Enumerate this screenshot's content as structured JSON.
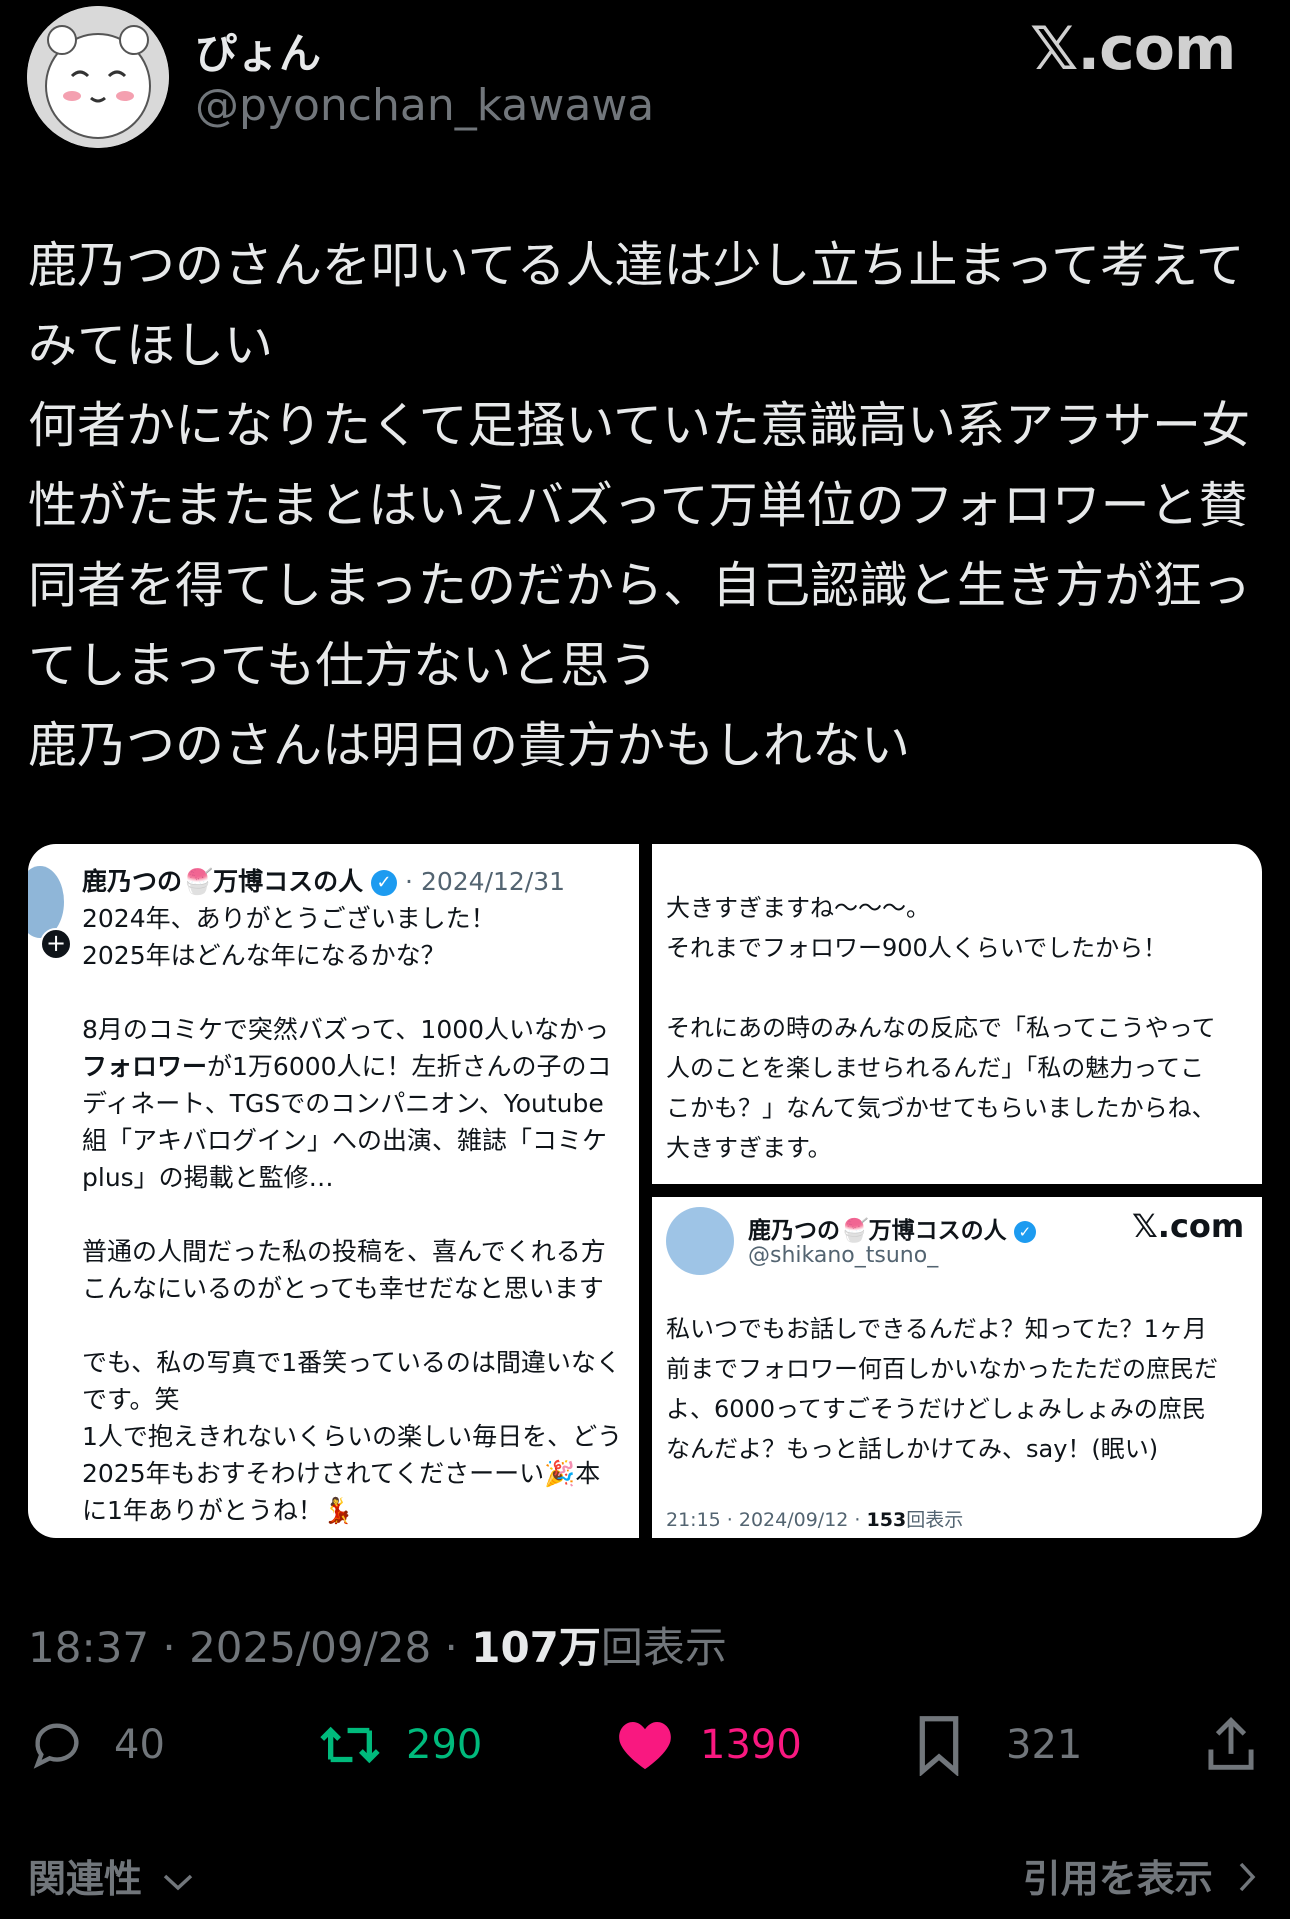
{
  "header": {
    "display_name": "ぴょん",
    "handle": "@pyonchan_kawawa",
    "watermark": "𝕏.com"
  },
  "tweet": {
    "text": "鹿乃つのさんを叩いてる人達は少し立ち止まって考えてみてほしい\n何者かになりたくて足掻いていた意識高い系アラサー女性がたまたまとはいえバズって万単位のフォロワーと賛同者を得てしまったのだから、自己認識と生き方が狂ってしまっても仕方ないと思う\n鹿乃つのさんは明日の貴方かもしれない"
  },
  "media": {
    "card1": {
      "name": "鹿乃つの🍧万博コスの人",
      "date": "· 2024/12/31",
      "lines": [
        "2024年、ありがとうございました！",
        "2025年はどんな年になるかな？",
        "",
        "8月のコミケで突然バズって、1000人いなかっ",
        "フォロワーが1万6000人に！左折さんの子のコ",
        "ディネート、TGSでのコンパニオン、Youtube",
        "組「アキバログイン」への出演、雑誌「コミケ",
        "plus」の掲載と監修…",
        "",
        "普通の人間だった私の投稿を、喜んでくれる方",
        "こんなにいるのがとっても幸せだなと思います",
        "",
        "でも、私の写真で1番笑っているのは間違いなく",
        "です。笑",
        "1人で抱えきれないくらいの楽しい毎日を、どう",
        "2025年もおすそわけされてくださーーい🎉本",
        "に1年ありがとうね！💃"
      ]
    },
    "card2": {
      "lines": [
        "大きすぎますね〜〜〜。",
        "それまでフォロワー900人くらいでしたから！",
        "",
        "それにあの時のみんなの反応で「私ってこうやって",
        "人のことを楽しませられるんだ」「私の魅力ってこ",
        "こかも？」なんて気づかせてもらいましたからね、",
        "大きすぎます。"
      ]
    },
    "card3": {
      "name": "鹿乃つの🍧万博コスの人",
      "handle": "@shikano_tsuno_",
      "watermark": "𝕏.com",
      "lines": [
        "私いつでもお話しできるんだよ？知ってた？1ヶ月",
        "前までフォロワー何百しかいなかったただの庶民だ",
        "よ、6000ってすごそうだけどしょみしょみの庶民",
        "なんだよ？もっと話しかけてみ、say！(眠い)"
      ],
      "time": "21:15 · 2024/09/12 · ",
      "views_num": "153",
      "views_label": "回表示"
    }
  },
  "meta": {
    "time": "18:37 · 2025/09/28 · ",
    "views_num": "107万",
    "views_label": "回表示"
  },
  "actions": {
    "replies": "40",
    "retweets": "290",
    "likes": "1390",
    "bookmarks": "321"
  },
  "footer": {
    "sort_label": "関連性",
    "quotes_label": "引用を表示"
  },
  "colors": {
    "retweet": "#00ba7c",
    "like": "#f91880",
    "grey": "#71767b"
  }
}
